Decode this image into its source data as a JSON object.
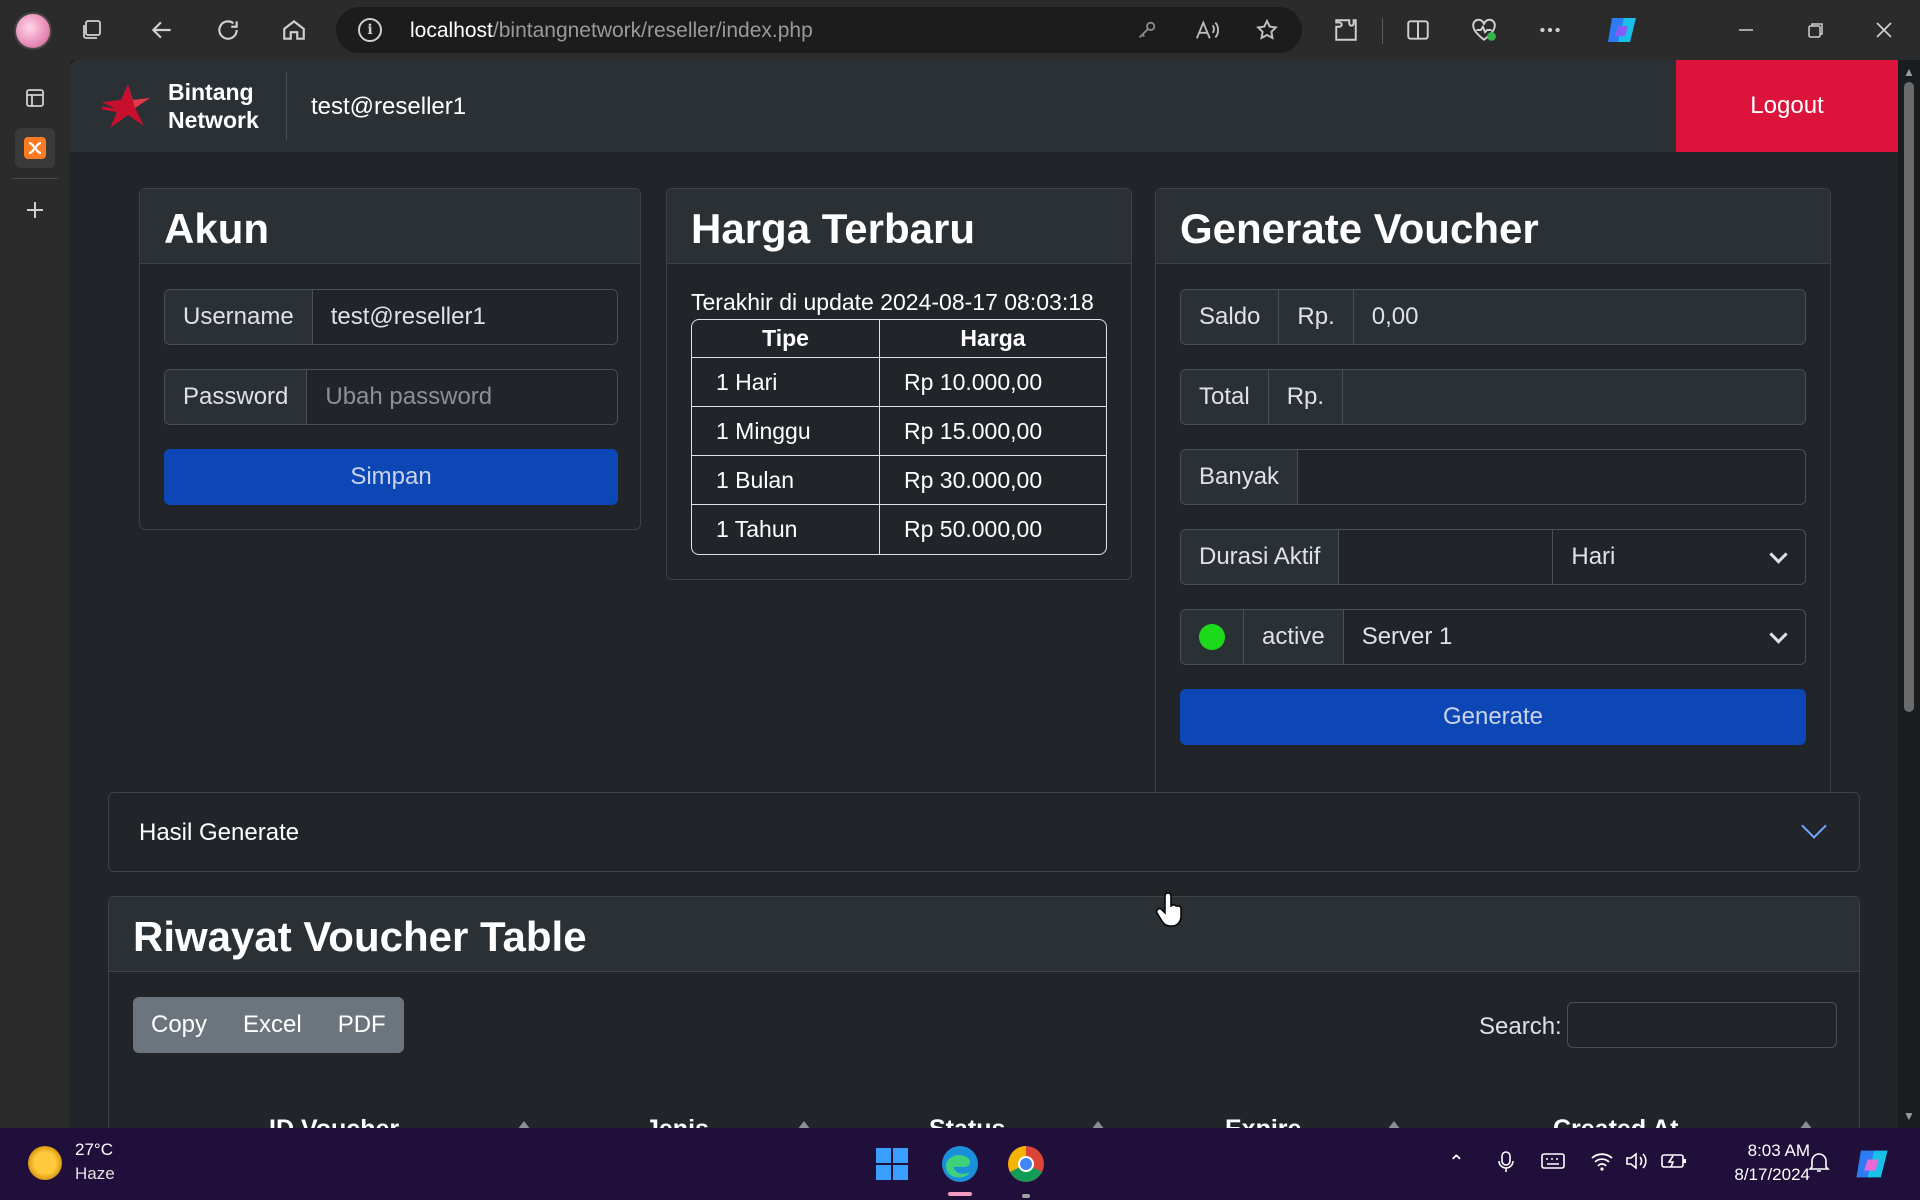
{
  "browser": {
    "url_host": "localhost",
    "url_path": "/bintangnetwork/reseller/index.php"
  },
  "navbar": {
    "brand_line1": "Bintang",
    "brand_line2": "Network",
    "user": "test@reseller1",
    "logout_label": "Logout",
    "logout_color": "#dc143c"
  },
  "akun": {
    "title": "Akun",
    "username_label": "Username",
    "username_value": "test@reseller1",
    "password_label": "Password",
    "password_placeholder": "Ubah password",
    "save_label": "Simpan"
  },
  "harga": {
    "title": "Harga Terbaru",
    "updated": "Terakhir di update 2024-08-17 08:03:18",
    "columns": [
      "Tipe",
      "Harga"
    ],
    "rows": [
      {
        "tipe": "1 Hari",
        "harga": "Rp 10.000,00"
      },
      {
        "tipe": "1 Minggu",
        "harga": "Rp 15.000,00"
      },
      {
        "tipe": "1 Bulan",
        "harga": "Rp 30.000,00"
      },
      {
        "tipe": "1 Tahun",
        "harga": "Rp 50.000,00"
      }
    ]
  },
  "voucher": {
    "title": "Generate Voucher",
    "saldo_label": "Saldo",
    "currency": "Rp.",
    "saldo_value": "0,00",
    "total_label": "Total",
    "total_value": "",
    "banyak_label": "Banyak",
    "banyak_value": "",
    "durasi_label": "Durasi Aktif",
    "durasi_value": "",
    "durasi_unit": "Hari",
    "status_label": "active",
    "status_color": "#1cd91c",
    "server": "Server 1",
    "generate_label": "Generate",
    "primary_color": "#0d47b5"
  },
  "hasil": {
    "label": "Hasil Generate"
  },
  "riwayat": {
    "title": "Riwayat Voucher Table",
    "buttons": [
      "Copy",
      "Excel",
      "PDF"
    ],
    "search_label": "Search:",
    "columns": [
      "ID Voucher",
      "Jenis",
      "Status",
      "Expire",
      "Created At"
    ]
  },
  "taskbar": {
    "temp": "27°C",
    "weather": "Haze",
    "time": "8:03 AM",
    "date": "8/17/2024"
  }
}
